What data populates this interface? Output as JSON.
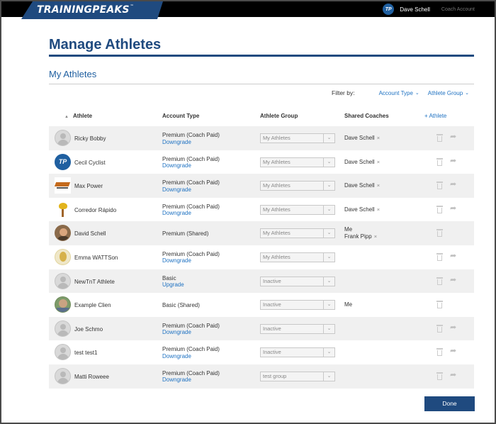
{
  "header": {
    "logo_text": "TRAININGPEAKS",
    "logo_tm": "™",
    "avatar_initials": "TP",
    "user_name": "Dave Schell",
    "coach_account": "Coach Account"
  },
  "page": {
    "title": "Manage Athletes",
    "section_title": "My Athletes"
  },
  "filter": {
    "label": "Filter by:",
    "account_type": "Account Type",
    "athlete_group": "Athlete Group"
  },
  "table": {
    "headers": {
      "athlete": "Athlete",
      "account_type": "Account Type",
      "athlete_group": "Athlete Group",
      "shared_coaches": "Shared Coaches",
      "add_athlete": "+ Athlete"
    },
    "rows": [
      {
        "name": "Ricky Bobby",
        "account": "Premium (Coach Paid)",
        "link": "Downgrade",
        "group": "My Athletes",
        "coaches": [
          "Dave Schell"
        ],
        "remove": [
          true
        ],
        "share": true
      },
      {
        "name": "Cecil Cyclist",
        "account": "Premium (Coach Paid)",
        "link": "Downgrade",
        "group": "My Athletes",
        "coaches": [
          "Dave Schell"
        ],
        "remove": [
          true
        ],
        "share": true
      },
      {
        "name": "Max Power",
        "account": "Premium (Coach Paid)",
        "link": "Downgrade",
        "group": "My Athletes",
        "coaches": [
          "Dave Schell"
        ],
        "remove": [
          true
        ],
        "share": true
      },
      {
        "name": "Corredor Rápido",
        "account": "Premium (Coach Paid)",
        "link": "Downgrade",
        "group": "My Athletes",
        "coaches": [
          "Dave Schell"
        ],
        "remove": [
          true
        ],
        "share": true
      },
      {
        "name": "David Schell",
        "account": "Premium (Shared)",
        "link": "",
        "group": "My Athletes",
        "coaches": [
          "Me",
          "Frank Pipp"
        ],
        "remove": [
          false,
          true
        ],
        "share": false
      },
      {
        "name": "Emma WATTSon",
        "account": "Premium (Coach Paid)",
        "link": "Downgrade",
        "group": "My Athletes",
        "coaches": [],
        "remove": [],
        "share": true
      },
      {
        "name": "NewTnT Athlete",
        "account": "Basic",
        "link": "Upgrade",
        "group": "Inactive",
        "coaches": [],
        "remove": [],
        "share": true
      },
      {
        "name": "Example Clien",
        "account": "Basic (Shared)",
        "link": "",
        "group": "Inactive",
        "coaches": [
          "Me"
        ],
        "remove": [
          false
        ],
        "share": false
      },
      {
        "name": "Joe Schmo",
        "account": "Premium (Coach Paid)",
        "link": "Downgrade",
        "group": "Inactive",
        "coaches": [],
        "remove": [],
        "share": true
      },
      {
        "name": "test test1",
        "account": "Premium (Coach Paid)",
        "link": "Downgrade",
        "group": "Inactive",
        "coaches": [],
        "remove": [],
        "share": true
      },
      {
        "name": "Matti Roweee",
        "account": "Premium (Coach Paid)",
        "link": "Downgrade",
        "group": "test group",
        "coaches": [],
        "remove": [],
        "share": true
      }
    ]
  },
  "footer": {
    "done_label": "Done"
  },
  "colors": {
    "brand_blue": "#1f4a7f",
    "link_blue": "#1f72c2"
  },
  "icons": {
    "sort": "sort-up-icon",
    "remove": "close-icon",
    "trash": "trash-icon",
    "share": "share-icon",
    "chevron": "chevron-down-icon"
  }
}
